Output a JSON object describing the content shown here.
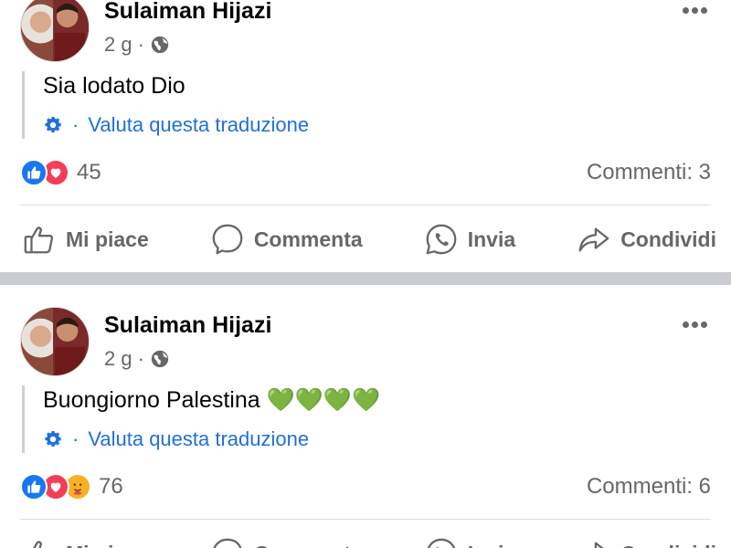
{
  "posts": [
    {
      "author": "Sulaiman Hijazi",
      "time": "2 g",
      "dot": "·",
      "text": "Sia lodato Dio",
      "translate_label": "Valuta questa traduzione",
      "reactions": [
        "like",
        "love"
      ],
      "reaction_count": "45",
      "comments": "Commenti: 3"
    },
    {
      "author": "Sulaiman Hijazi",
      "time": "2 g",
      "dot": "·",
      "text": "Buongiorno Palestina 💚💚💚💚",
      "translate_label": "Valuta questa traduzione",
      "reactions": [
        "like",
        "love",
        "care"
      ],
      "reaction_count": "76",
      "comments": "Commenti: 6"
    }
  ],
  "actions": {
    "like": "Mi piace",
    "comment": "Commenta",
    "send": "Invia",
    "share": "Condividi"
  },
  "icons": {
    "like": "thumbs-up-icon",
    "comment": "speech-bubble-icon",
    "send": "whatsapp-icon",
    "share": "share-arrow-icon",
    "globe": "globe-icon",
    "gear": "gear-icon",
    "more": "more-dots-icon"
  },
  "colors": {
    "link_blue": "#216fdb",
    "like_blue": "#1877f2",
    "love_red": "#f33e58",
    "care_yellow": "#f7b125",
    "secondary_text": "#65676b",
    "separator": "#c9ccd1"
  }
}
